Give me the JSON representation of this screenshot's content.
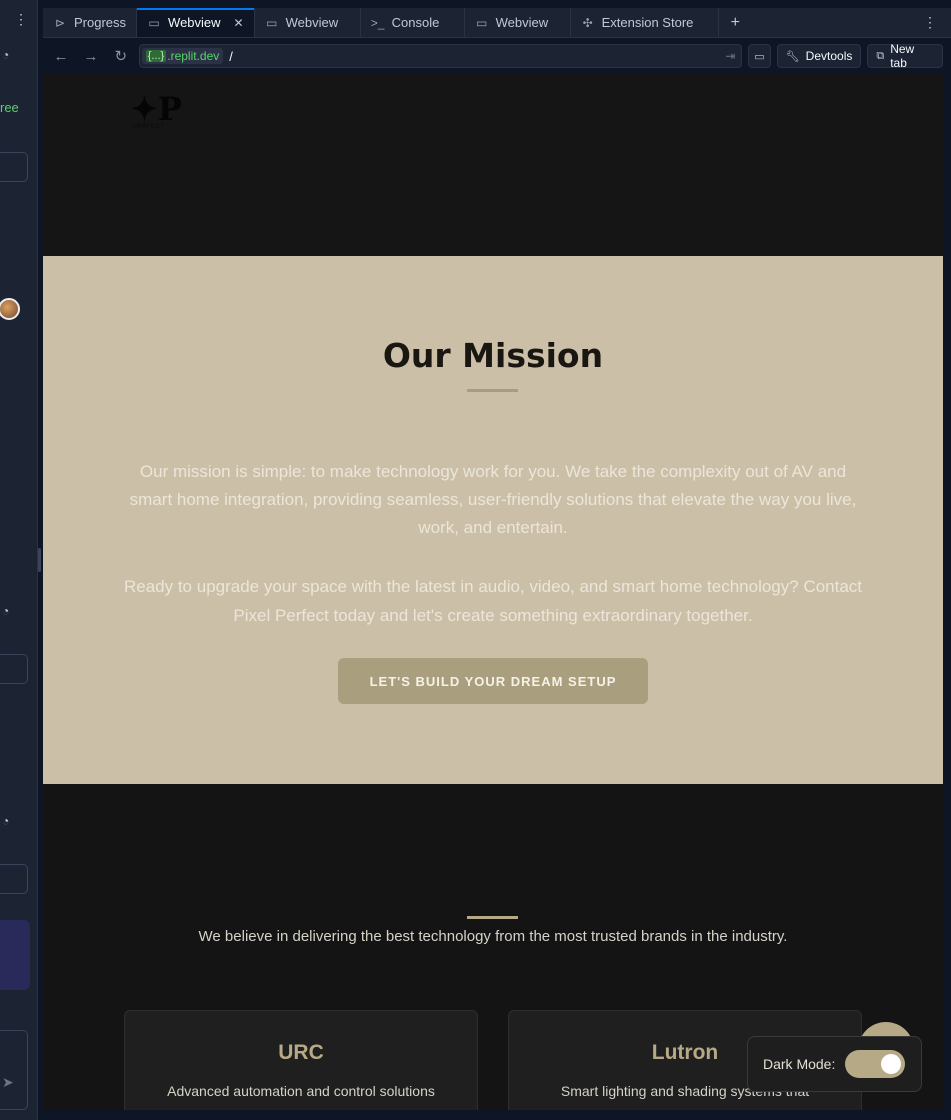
{
  "tabs": [
    {
      "label": "Progress",
      "icon": "progress-icon"
    },
    {
      "label": "Webview",
      "icon": "monitor-icon",
      "active": true
    },
    {
      "label": "Webview",
      "icon": "monitor-icon"
    },
    {
      "label": "Console",
      "icon": "terminal-icon"
    },
    {
      "label": "Webview",
      "icon": "monitor-icon"
    },
    {
      "label": "Extension Store",
      "icon": "puzzle-icon"
    }
  ],
  "address": {
    "domain_brace": "{...}",
    "domain": ".replit.dev",
    "path": "/"
  },
  "toolbar": {
    "devtools_label": "Devtools",
    "newtab_label": "New tab"
  },
  "left_panel": {
    "free_text": "ree"
  },
  "site": {
    "logo_text": "PERFECT",
    "mission": {
      "title": "Our Mission",
      "paragraph1": "Our mission is simple: to make technology work for you. We take the complexity out of AV and smart home integration, providing seamless, user-friendly solutions that elevate the way you live, work, and entertain.",
      "paragraph2": "Ready to upgrade your space with the latest in audio, video, and smart home technology? Contact Pixel Perfect today and let's create something extraordinary together.",
      "cta": "LET'S BUILD YOUR DREAM SETUP"
    },
    "brands": {
      "intro": "We believe in delivering the best technology from the most trusted brands in the industry.",
      "cards": [
        {
          "name": "URC",
          "desc": "Advanced automation and control solutions"
        },
        {
          "name": "Lutron",
          "desc": "Smart lighting and shading systems that"
        }
      ]
    },
    "dark_mode": {
      "label": "Dark Mode:",
      "enabled": true
    }
  },
  "colors": {
    "mission_bg": "#cbbfa7",
    "accent_gold": "#b5a986",
    "page_dark": "#141414",
    "ide_bg": "#0e1525",
    "active_tab_accent": "#0079f2"
  }
}
